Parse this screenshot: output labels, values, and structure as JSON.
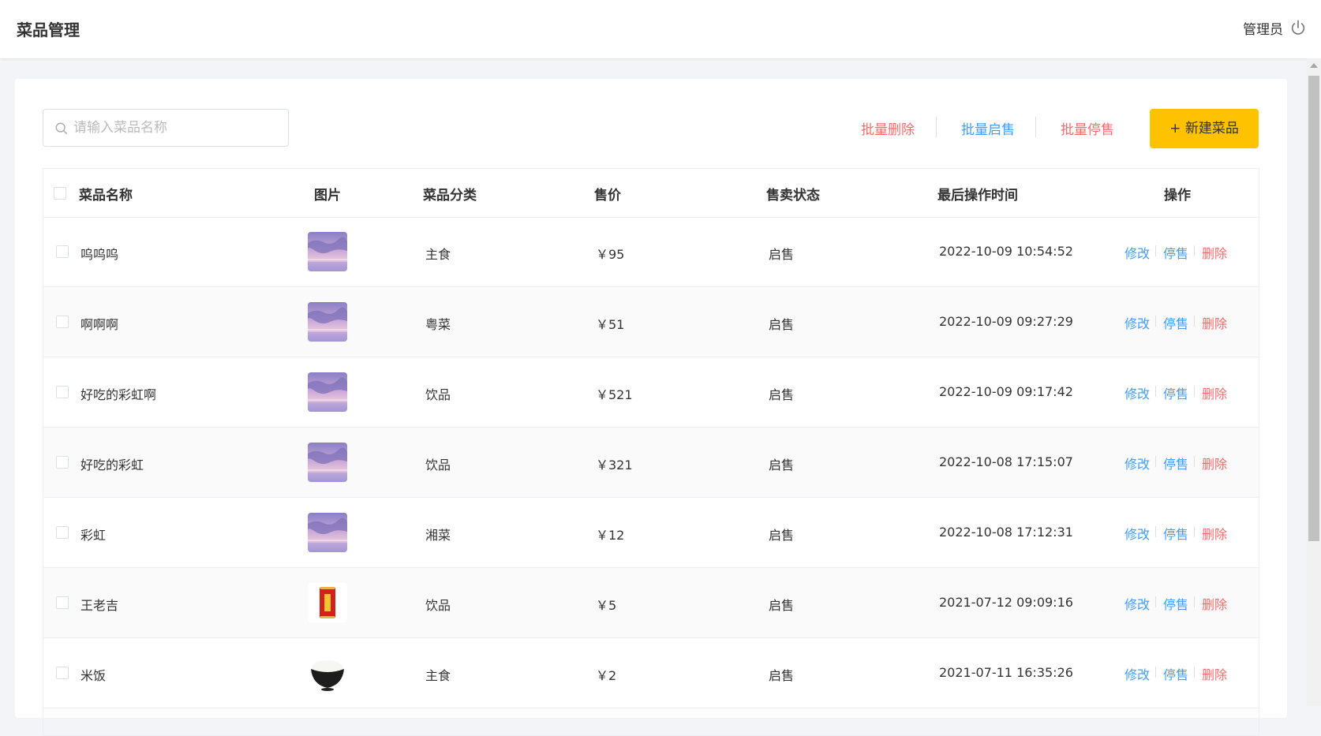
{
  "header": {
    "title": "菜品管理",
    "user": "管理员",
    "logout_icon": "power-icon"
  },
  "toolbar": {
    "search_placeholder": "请输入菜品名称",
    "batch_delete": "批量删除",
    "batch_enable": "批量启售",
    "batch_disable": "批量停售",
    "new_button": "+ 新建菜品"
  },
  "colors": {
    "accent": "#ffc200",
    "link_blue": "#419eff",
    "link_red": "#f56c6c"
  },
  "table": {
    "columns": [
      "菜品名称",
      "图片",
      "菜品分类",
      "售价",
      "售卖状态",
      "最后操作时间",
      "操作"
    ],
    "actions": {
      "edit": "修改",
      "disable": "停售",
      "delete": "删除"
    },
    "rows": [
      {
        "name": "呜呜呜",
        "image": "sky-photo",
        "category": "主食",
        "price": "￥95",
        "status": "启售",
        "time": "2022-10-09 10:54:52"
      },
      {
        "name": "啊啊啊",
        "image": "sky-photo",
        "category": "粤菜",
        "price": "￥51",
        "status": "启售",
        "time": "2022-10-09 09:27:29"
      },
      {
        "name": "好吃的彩虹啊",
        "image": "sky-photo",
        "category": "饮品",
        "price": "￥521",
        "status": "启售",
        "time": "2022-10-09 09:17:42"
      },
      {
        "name": "好吃的彩虹",
        "image": "sky-photo",
        "category": "饮品",
        "price": "￥321",
        "status": "启售",
        "time": "2022-10-08 17:15:07"
      },
      {
        "name": "彩虹",
        "image": "sky-photo",
        "category": "湘菜",
        "price": "￥12",
        "status": "启售",
        "time": "2022-10-08 17:12:31"
      },
      {
        "name": "王老吉",
        "image": "red-can",
        "category": "饮品",
        "price": "￥5",
        "status": "启售",
        "time": "2021-07-12 09:09:16"
      },
      {
        "name": "米饭",
        "image": "rice-bowl",
        "category": "主食",
        "price": "￥2",
        "status": "启售",
        "time": "2021-07-11 16:35:26"
      }
    ]
  }
}
